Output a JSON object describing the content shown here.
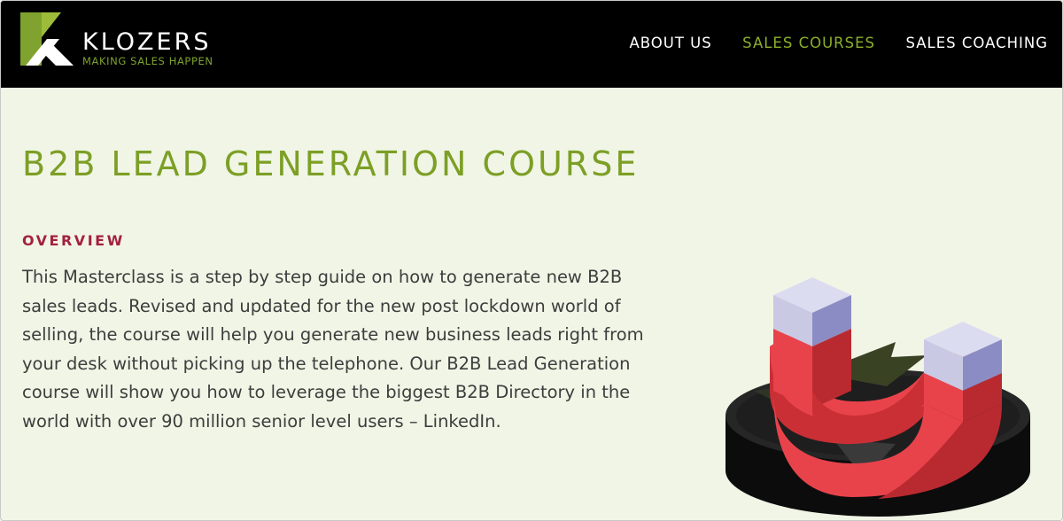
{
  "header": {
    "brand_name": "KLOZERS",
    "tagline": "MAKING SALES HAPPEN",
    "nav": [
      {
        "label": "ABOUT US",
        "active": false
      },
      {
        "label": "SALES COURSES",
        "active": true
      },
      {
        "label": "SALES COACHING",
        "active": false
      }
    ]
  },
  "main": {
    "title": "B2B LEAD GENERATION COURSE",
    "section_heading": "OVERVIEW",
    "description": "This Masterclass is a step by step guide on how to generate new B2B sales leads.  Revised and updated for the new post lockdown world of selling, the course will help you generate new business leads right from your desk without picking up the telephone.  Our B2B Lead Generation course will show you how to leverage the biggest B2B Directory in the world with over 90 million senior level users – LinkedIn."
  },
  "illustration": {
    "icon": "magnet-icon"
  },
  "colors": {
    "header_bg": "#000000",
    "page_bg": "#f1f5e6",
    "accent_green": "#7c9f25",
    "heading_red": "#a3213e",
    "magnet_red": "#e8434b"
  }
}
